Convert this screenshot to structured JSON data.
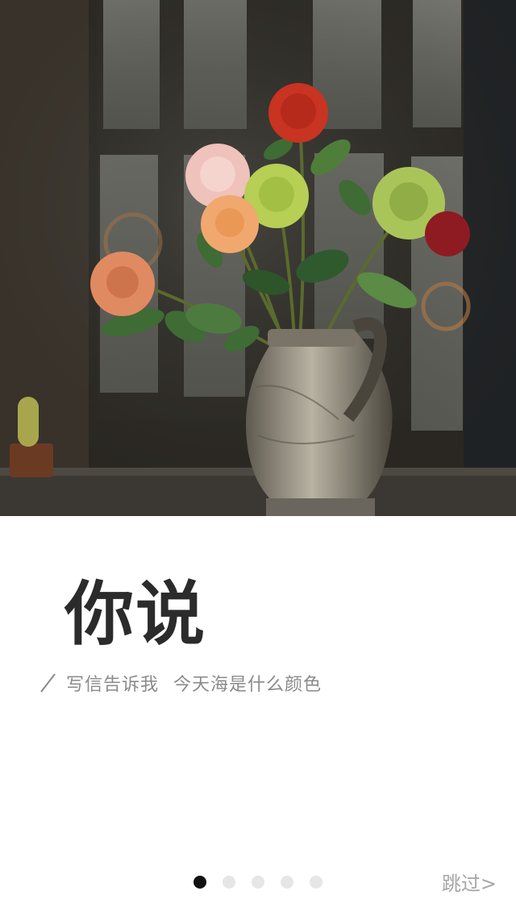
{
  "hero_image": {
    "subject": "roses-in-vase-by-window",
    "colors": {
      "frame": "#2c2924",
      "glass": "#6d6e68",
      "rose_red": "#c93321",
      "rose_pink": "#efc2bb",
      "rose_green": "#b7cf55",
      "rose_peach": "#f0a86e",
      "leaf": "#3e6a35",
      "vase": "#a39e8e"
    }
  },
  "title": "你说",
  "subtitle": {
    "part1": "写信告诉我",
    "part2": "今天海是什么颜色"
  },
  "pagination": {
    "total": 5,
    "current": 1
  },
  "skip_label": "跳过>",
  "colors": {
    "title": "#2b2b2b",
    "subtitle": "#8a8a8a",
    "dot_active": "#111111",
    "dot_inactive": "#e6e6e6",
    "skip": "#a6a6a6"
  }
}
